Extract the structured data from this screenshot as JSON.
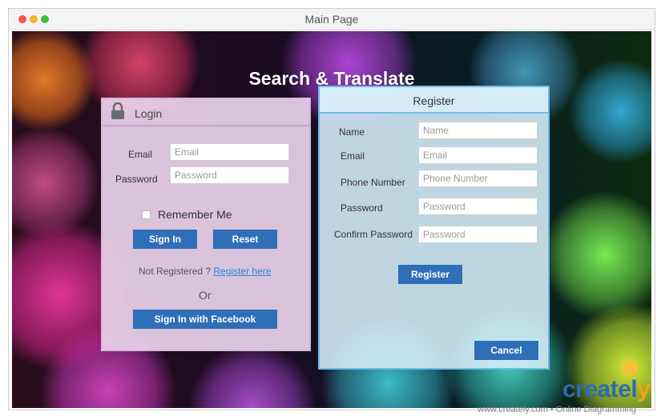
{
  "window": {
    "title": "Main Page"
  },
  "page": {
    "title": "Search & Translate"
  },
  "login": {
    "title": "Login",
    "email_label": "Email",
    "email_placeholder": "Email",
    "password_label": "Password",
    "password_placeholder": "Password",
    "remember_label": "Remember Me",
    "remember_checked": false,
    "sign_in_button": "Sign In",
    "reset_button": "Reset",
    "not_registered_text": "Not Registered ?",
    "register_link": "Register here",
    "or_text": "Or",
    "facebook_button": "Sign In with Facebook"
  },
  "register": {
    "title": "Register",
    "fields": [
      {
        "label": "Name",
        "placeholder": "Name"
      },
      {
        "label": "Email",
        "placeholder": "Email"
      },
      {
        "label": "Phone Number",
        "placeholder": "Phone Number"
      },
      {
        "label": "Password",
        "placeholder": "Password"
      },
      {
        "label": "Confirm Password",
        "placeholder": "Password"
      }
    ],
    "register_button": "Register",
    "cancel_button": "Cancel"
  },
  "watermark": {
    "logo_main": "createl",
    "logo_end": "y",
    "footer": "www.creately.com • Online Diagramming"
  },
  "colors": {
    "button_blue": "#2f6fb8",
    "login_border": "#d9b6da",
    "register_border": "#6fb9e6",
    "link": "#2c84d6"
  },
  "icons": [
    "lock-icon",
    "lightbulb-icon"
  ]
}
